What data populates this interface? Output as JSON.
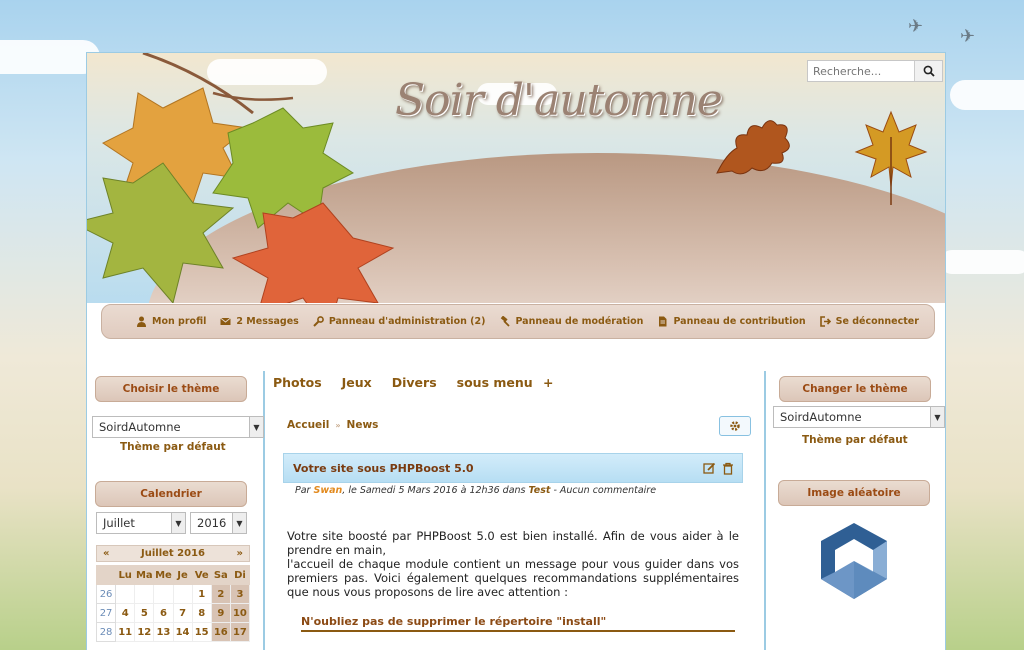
{
  "header": {
    "site_title": "Soir d'automne",
    "search_placeholder": "Recherche..."
  },
  "usermenu": [
    {
      "label": "Mon profil",
      "icon": "user-icon"
    },
    {
      "label": "2 Messages",
      "icon": "envelope-icon"
    },
    {
      "label": "Panneau d'administration (2)",
      "icon": "wrench-icon"
    },
    {
      "label": "Panneau de modération",
      "icon": "gavel-icon"
    },
    {
      "label": "Panneau de contribution",
      "icon": "file-icon"
    },
    {
      "label": "Se déconnecter",
      "icon": "sign-out-icon"
    }
  ],
  "left": {
    "theme_block_title": "Choisir le thème",
    "theme_select_value": "SoirdAutomne",
    "theme_default_link": "Thème par défaut",
    "calendar_block_title": "Calendrier",
    "month_select_value": "Juillet",
    "year_select_value": "2016",
    "calendar_header": "Juillet 2016",
    "prev": "«",
    "next": "»",
    "weekdays": [
      "Lu",
      "Ma",
      "Me",
      "Je",
      "Ve",
      "Sa",
      "Di"
    ],
    "weeks": [
      {
        "wk": "26",
        "days": [
          "",
          "",
          "",
          "",
          "1",
          "2",
          "3"
        ]
      },
      {
        "wk": "27",
        "days": [
          "4",
          "5",
          "6",
          "7",
          "8",
          "9",
          "10"
        ]
      },
      {
        "wk": "28",
        "days": [
          "11",
          "12",
          "13",
          "14",
          "15",
          "16",
          "17"
        ]
      }
    ]
  },
  "main": {
    "menu": [
      "Photos",
      "Jeux",
      "Divers",
      "sous menu"
    ],
    "submenu_marker": "+",
    "breadcrumb": [
      "Accueil",
      "News"
    ],
    "breadcrumb_sep": "»",
    "news_title": "Votre site sous PHPBoost 5.0",
    "meta_prefix": "Par ",
    "meta_author": "Swan",
    "meta_date": ", le Samedi 5 Mars 2016 à 12h36 dans ",
    "meta_category": "Test",
    "meta_suffix": " - Aucun commentaire",
    "body_p1": "Votre site boosté par PHPBoost 5.0 est bien installé. Afin de vous aider à le prendre en main,",
    "body_p2": "l'accueil de chaque module contient un message pour vous guider dans vos premiers pas. Voici également quelques recommandations supplémentaires que nous vous proposons de lire avec attention :",
    "section_title": "N'oubliez pas de supprimer le répertoire \"install\""
  },
  "right": {
    "theme_block_title": "Changer le thème",
    "theme_select_value": "SoirdAutomne",
    "theme_default_link": "Thème par défaut",
    "random_image_title": "Image aléatoire"
  },
  "colors": {
    "accent": "#8b5a12",
    "block_title": "#9b4b14",
    "border_blue": "#9ccbe3"
  }
}
